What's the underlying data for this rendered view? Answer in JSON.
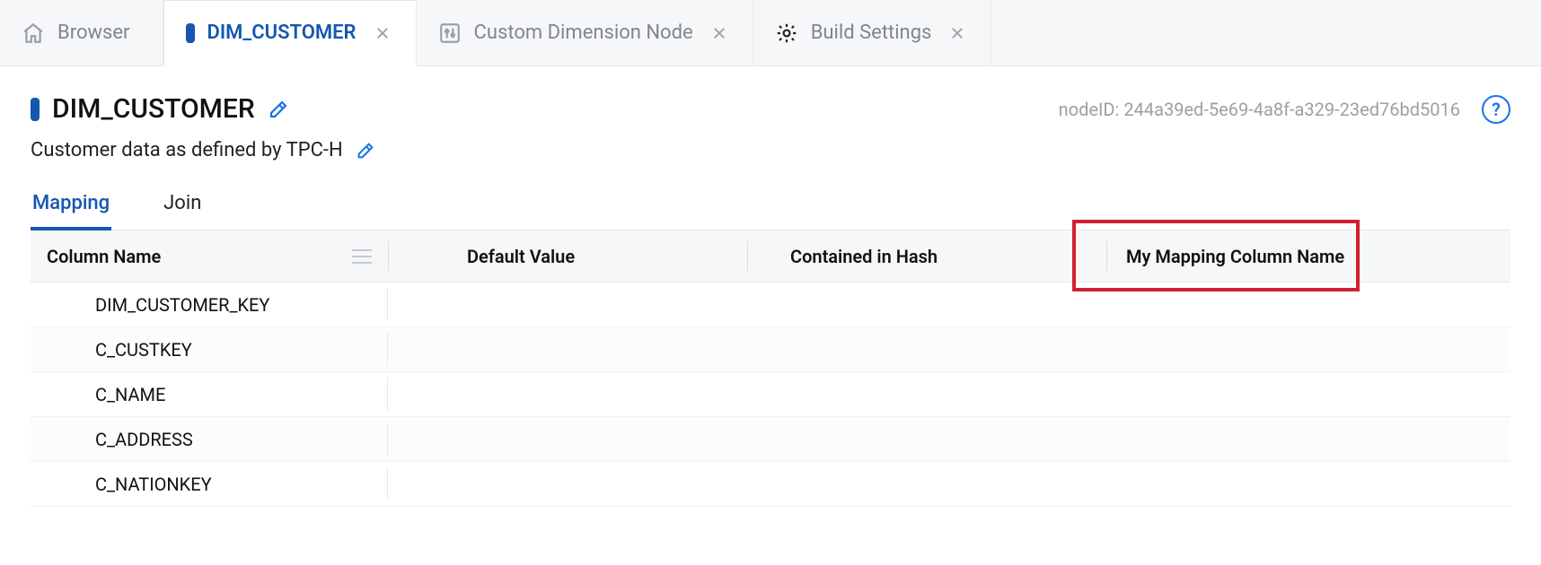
{
  "tabs": {
    "browser": {
      "label": "Browser"
    },
    "items": [
      {
        "label": "DIM_CUSTOMER",
        "icon": "bluetag",
        "active": true
      },
      {
        "label": "Custom Dimension Node",
        "icon": "sliders"
      },
      {
        "label": "Build Settings",
        "icon": "gear"
      }
    ]
  },
  "header": {
    "title": "DIM_CUSTOMER",
    "subtitle": "Customer data as defined by TPC-H",
    "nodeId": "nodeID: 244a39ed-5e69-4a8f-a329-23ed76bd5016"
  },
  "localTabs": {
    "mapping": "Mapping",
    "join": "Join",
    "active": "mapping"
  },
  "grid": {
    "columns": {
      "name": "Column Name",
      "default": "Default Value",
      "hash": "Contained in Hash",
      "map": "My Mapping Column Name"
    },
    "rows": [
      {
        "name": "DIM_CUSTOMER_KEY"
      },
      {
        "name": "C_CUSTKEY"
      },
      {
        "name": "C_NAME"
      },
      {
        "name": "C_ADDRESS"
      },
      {
        "name": "C_NATIONKEY"
      }
    ]
  },
  "colors": {
    "accent": "#1557b0",
    "highlight": "#d2202f"
  }
}
